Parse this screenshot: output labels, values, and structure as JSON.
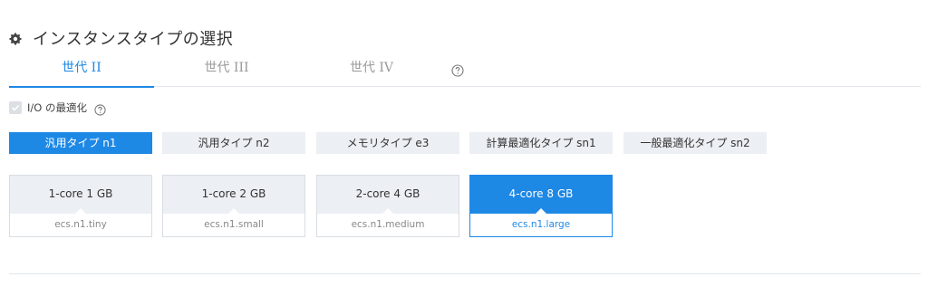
{
  "section": {
    "title": "インスタンスタイプの選択",
    "icon": "gear-icon"
  },
  "tabs": [
    {
      "label": "世代 II",
      "active": true
    },
    {
      "label": "世代 III",
      "active": false
    },
    {
      "label": "世代 IV",
      "active": false
    }
  ],
  "io_optimization": {
    "label": "I/O の最適化",
    "checked": true
  },
  "instance_types": [
    {
      "label": "汎用タイプ n1",
      "active": true
    },
    {
      "label": "汎用タイプ n2",
      "active": false
    },
    {
      "label": "メモリタイプ e3",
      "active": false
    },
    {
      "label": "計算最適化タイプ sn1",
      "active": false
    },
    {
      "label": "一般最適化タイプ sn2",
      "active": false
    }
  ],
  "specs": [
    {
      "spec": "1-core 1 GB",
      "name": "ecs.n1.tiny",
      "selected": false
    },
    {
      "spec": "1-core 2 GB",
      "name": "ecs.n1.small",
      "selected": false
    },
    {
      "spec": "2-core 4 GB",
      "name": "ecs.n1.medium",
      "selected": false
    },
    {
      "spec": "4-core 8 GB",
      "name": "ecs.n1.large",
      "selected": true
    }
  ],
  "colors": {
    "accent": "#1e88e5",
    "inactive_bg": "#eceff3",
    "muted_text": "#999999"
  }
}
